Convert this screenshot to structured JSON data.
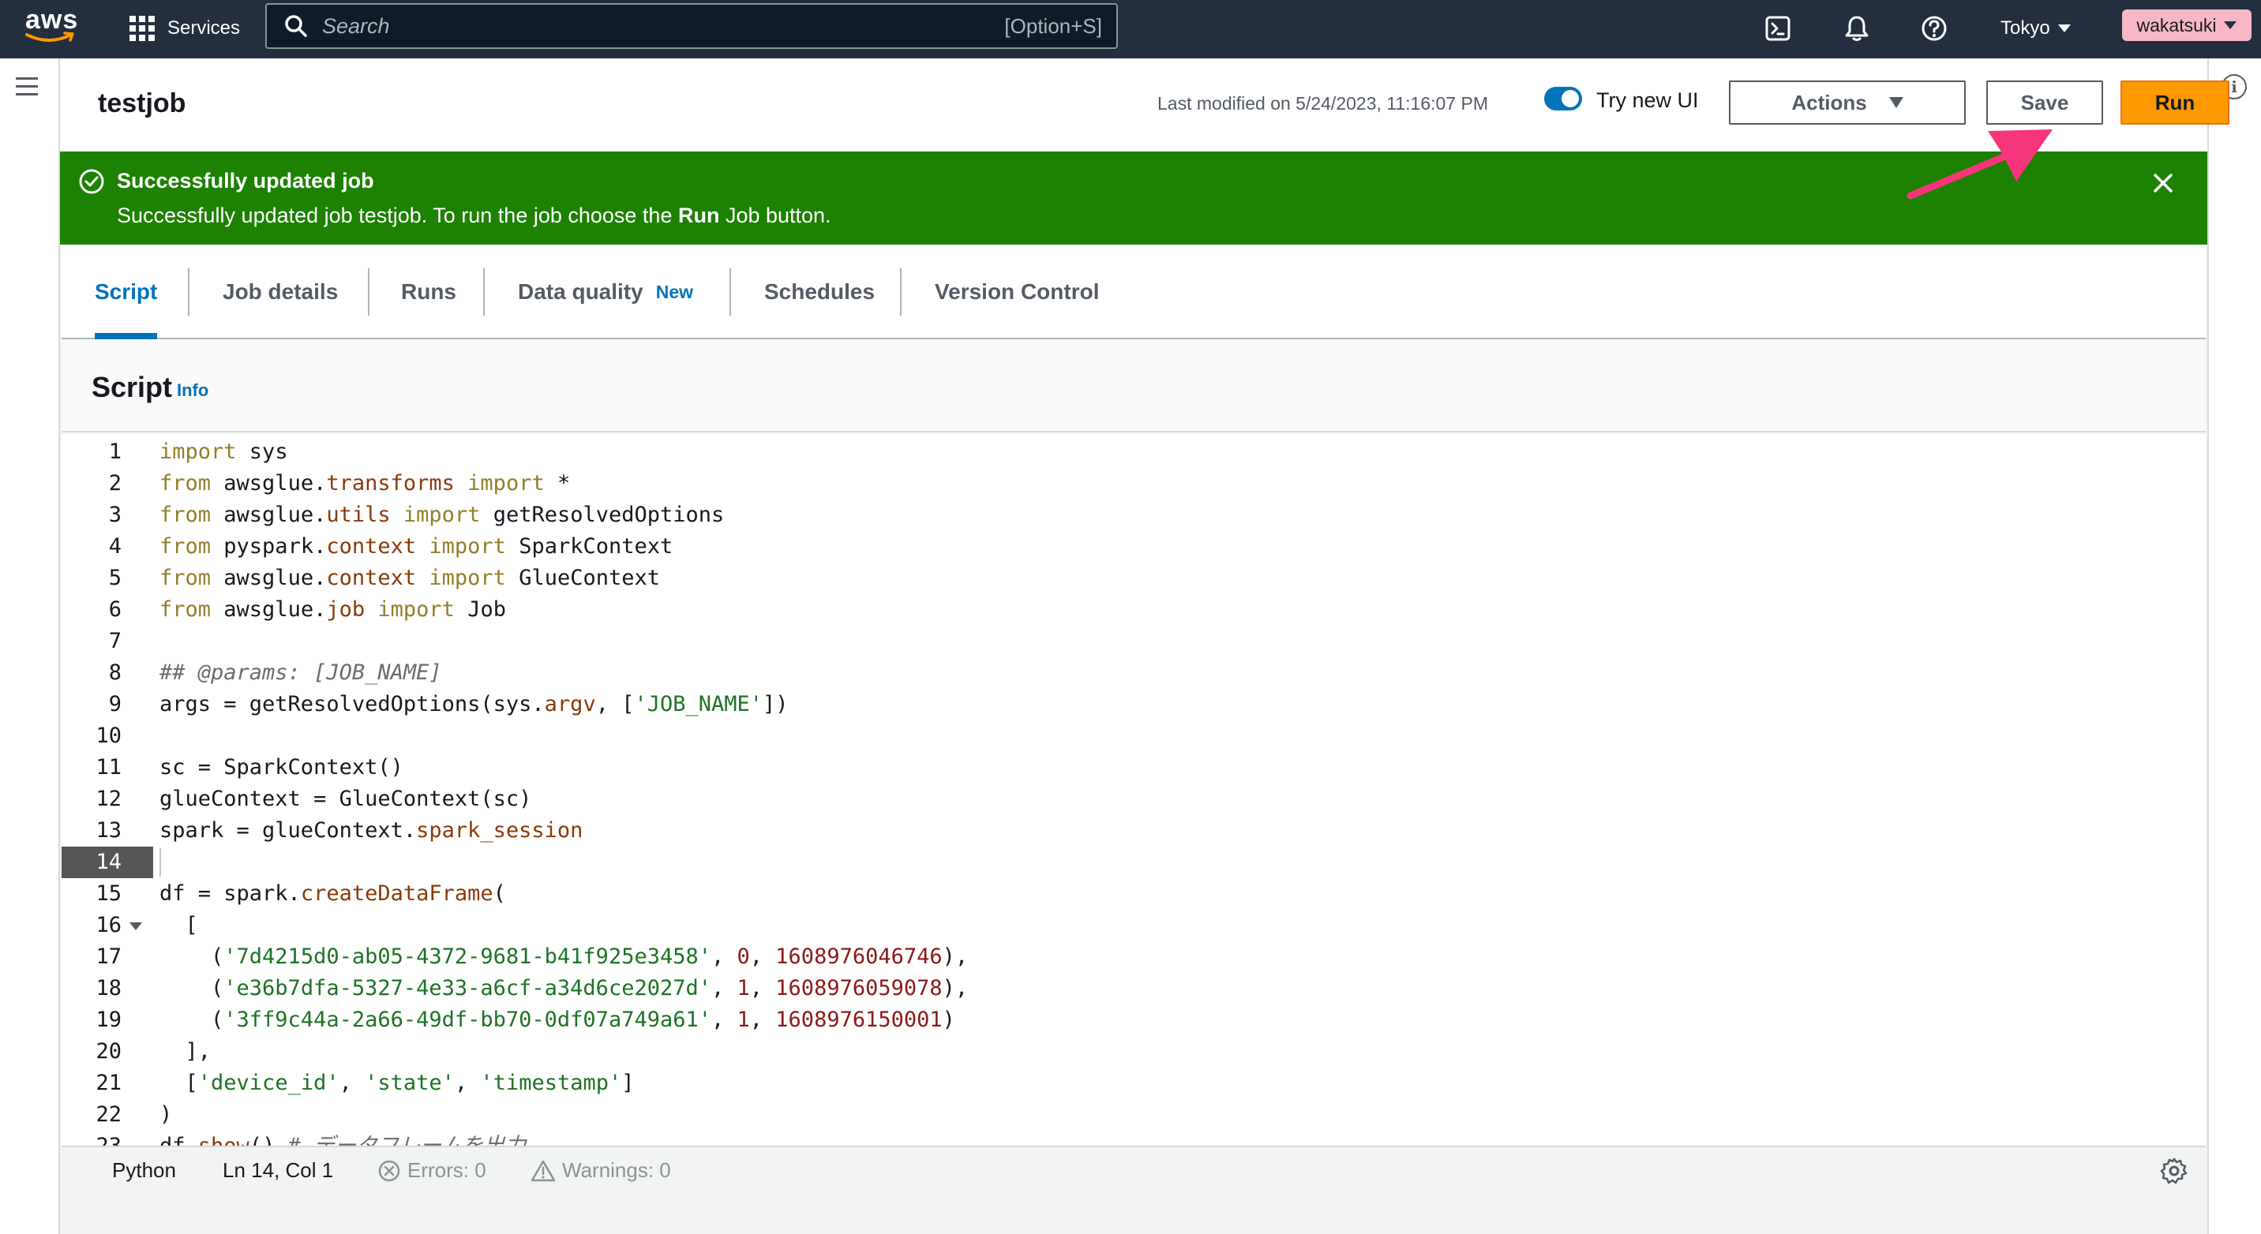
{
  "topnav": {
    "logo_text": "aws",
    "services_label": "Services",
    "search_placeholder": "Search",
    "search_shortcut": "[Option+S]",
    "region": "Tokyo",
    "user": "wakatsuki"
  },
  "header": {
    "job_name": "testjob",
    "last_modified": "Last modified on 5/24/2023, 11:16:07 PM",
    "toggle_label": "Try new UI",
    "toggle_on": true,
    "actions_label": "Actions",
    "save_label": "Save",
    "run_label": "Run"
  },
  "flash": {
    "title": "Successfully updated job",
    "message_prefix": "Successfully updated job testjob. To run the job choose the ",
    "message_bold": "Run",
    "message_suffix": " Job button."
  },
  "tabs": [
    {
      "label": "Script",
      "active": true
    },
    {
      "label": "Job details",
      "active": false
    },
    {
      "label": "Runs",
      "active": false
    },
    {
      "label": "Data quality",
      "badge": "New",
      "active": false
    },
    {
      "label": "Schedules",
      "active": false
    },
    {
      "label": "Version Control",
      "active": false
    }
  ],
  "script": {
    "title": "Script",
    "info_label": "Info",
    "current_line": 14,
    "lines": [
      "import sys",
      "from awsglue.transforms import *",
      "from awsglue.utils import getResolvedOptions",
      "from pyspark.context import SparkContext",
      "from awsglue.context import GlueContext",
      "from awsglue.job import Job",
      "",
      "## @params: [JOB_NAME]",
      "args = getResolvedOptions(sys.argv, ['JOB_NAME'])",
      "",
      "sc = SparkContext()",
      "glueContext = GlueContext(sc)",
      "spark = glueContext.spark_session",
      "",
      "df = spark.createDataFrame(",
      "  [",
      "    ('7d4215d0-ab05-4372-9681-b41f925e3458', 0, 1608976046746),",
      "    ('e36b7dfa-5327-4e33-a6cf-a34d6ce2027d', 1, 1608976059078),",
      "    ('3ff9c44a-2a66-49df-bb70-0df07a749a61', 1, 1608976150001)",
      "  ],",
      "  ['device_id', 'state', 'timestamp']",
      ")",
      "df.show() # データフレームを出力"
    ]
  },
  "status_bar": {
    "language": "Python",
    "position": "Ln 14, Col 1",
    "errors": "Errors: 0",
    "warnings": "Warnings: 0"
  },
  "colors": {
    "nav_bg": "#232f3e",
    "success": "#1d8102",
    "primary": "#ff9900",
    "link": "#0073bb",
    "annotation_arrow": "#f7357c"
  }
}
